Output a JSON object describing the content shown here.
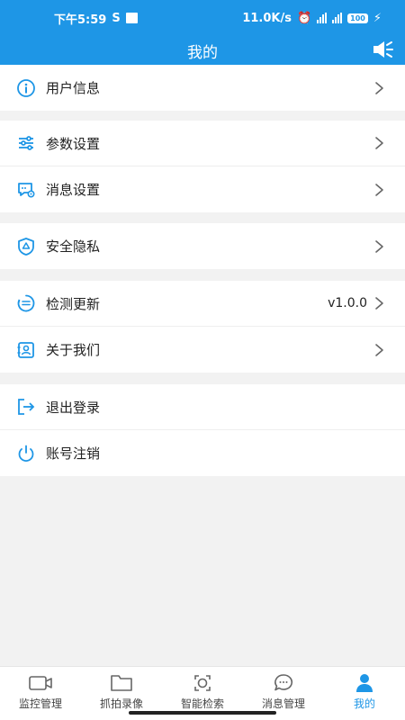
{
  "status_bar": {
    "time": "下午5:59",
    "network_speed": "11.0K/s",
    "battery": "100"
  },
  "header": {
    "title": "我的"
  },
  "menu_groups": [
    [
      {
        "label": "用户信息",
        "icon": "user-info-icon"
      }
    ],
    [
      {
        "label": "参数设置",
        "icon": "sliders-icon"
      },
      {
        "label": "消息设置",
        "icon": "message-settings-icon"
      }
    ],
    [
      {
        "label": "安全隐私",
        "icon": "shield-icon"
      }
    ],
    [
      {
        "label": "检测更新",
        "icon": "update-icon",
        "value": "v1.0.0"
      },
      {
        "label": "关于我们",
        "icon": "about-icon"
      }
    ],
    [
      {
        "label": "退出登录",
        "icon": "logout-icon"
      },
      {
        "label": "账号注销",
        "icon": "power-icon"
      }
    ]
  ],
  "tabs": [
    {
      "label": "监控管理",
      "icon": "camera-icon"
    },
    {
      "label": "抓拍录像",
      "icon": "folder-icon"
    },
    {
      "label": "智能检索",
      "icon": "face-scan-icon"
    },
    {
      "label": "消息管理",
      "icon": "chat-icon"
    },
    {
      "label": "我的",
      "icon": "person-icon",
      "active": true
    }
  ],
  "colors": {
    "primary": "#1e96e6",
    "background": "#f2f2f2",
    "text": "#222222"
  }
}
